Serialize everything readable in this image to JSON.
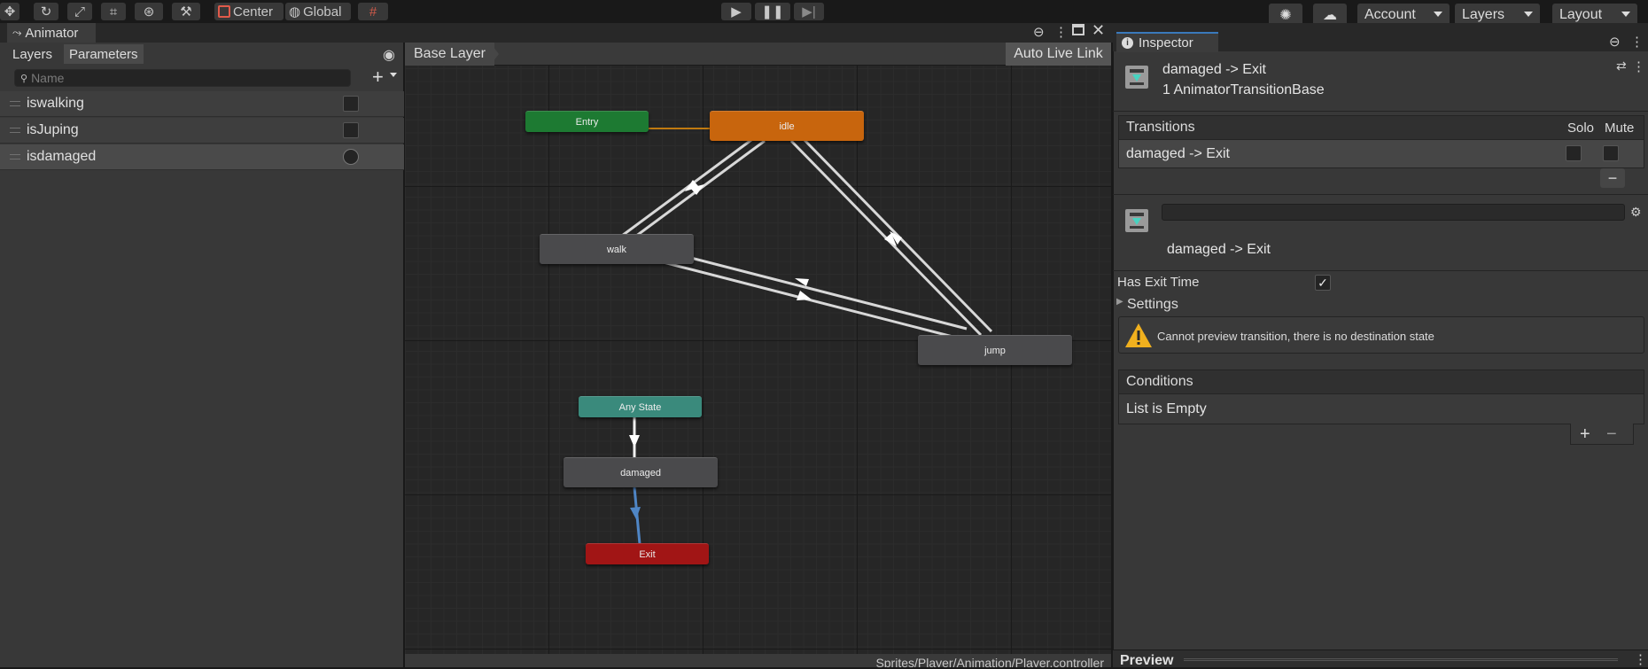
{
  "toolbar": {
    "center_label": "Center",
    "global_label": "Global",
    "account_label": "Account",
    "layers_label": "Layers",
    "layout_label": "Layout"
  },
  "animator": {
    "tab_label": "Animator",
    "left_tabs": [
      "Layers",
      "Parameters"
    ],
    "search_placeholder": "Name",
    "parameters": [
      {
        "name": "iswalking",
        "type": "bool"
      },
      {
        "name": "isJuping",
        "type": "bool"
      },
      {
        "name": "isdamaged",
        "type": "trigger"
      }
    ],
    "breadcrumb": "Base Layer",
    "live_link_label": "Auto Live Link",
    "states": {
      "entry": "Entry",
      "idle": "idle",
      "walk": "walk",
      "jump": "jump",
      "any_state": "Any State",
      "damaged": "damaged",
      "exit": "Exit"
    },
    "footer_path": "Sprites/Player/Animation/Player.controller",
    "colors": {
      "entry": "#1d7a32",
      "default_state": "#c8650d",
      "state": "#4a4a4c",
      "any_state": "#3a8a7c",
      "exit": "#a11515",
      "selected_transition": "#4f86c6"
    }
  },
  "inspector": {
    "tab_label": "Inspector",
    "title": "damaged -> Exit",
    "subtitle": "1 AnimatorTransitionBase",
    "transitions_header": "Transitions",
    "solo_label": "Solo",
    "mute_label": "Mute",
    "transition_row": "damaged -> Exit",
    "name_field_value": "",
    "transition_name": "damaged -> Exit",
    "has_exit_time_label": "Has Exit Time",
    "has_exit_time": true,
    "settings_label": "Settings",
    "warning_text": "Cannot preview transition, there is no destination state",
    "conditions_header": "Conditions",
    "conditions_empty": "List is Empty",
    "preview_label": "Preview"
  }
}
